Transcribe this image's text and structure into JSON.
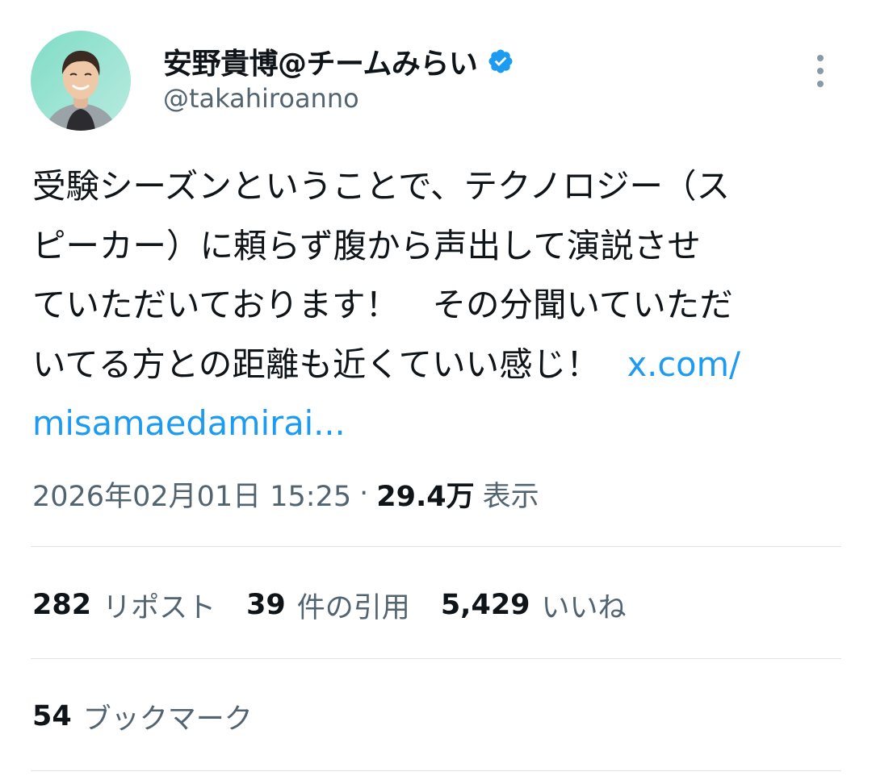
{
  "author": {
    "display_name": "安野貴博@チームみらい",
    "handle": "@takahiroanno",
    "verified": true,
    "avatar_icon": "avatar-photo"
  },
  "menu": {
    "icon": "more-vertical-icon"
  },
  "tweet": {
    "lines": [
      "受験シーズンということで、テクノロジー（ス",
      "ピーカー）に頼らず腹から声出して演説させ",
      "ていただいております！　その分聞いていただ",
      "いてる方との距離も近くていい感じ！"
    ],
    "link_part1": "x.com/",
    "link_part2": "misamaedamirai..."
  },
  "meta": {
    "timestamp": "2026年02月01日 15:25",
    "separator": "·",
    "views": "29.4万",
    "views_label": "表示"
  },
  "stats": {
    "reposts": {
      "value": "282",
      "label": "リポスト"
    },
    "quotes": {
      "value": "39",
      "label": "件の引用"
    },
    "likes": {
      "value": "5,429",
      "label": "いいね"
    },
    "bookmarks": {
      "value": "54",
      "label": "ブックマーク"
    }
  },
  "colors": {
    "text_primary": "#0f1419",
    "text_secondary": "#536471",
    "link": "#1d9bf0",
    "verified_badge": "#1d9bf0",
    "divider": "#dfe3e7"
  }
}
